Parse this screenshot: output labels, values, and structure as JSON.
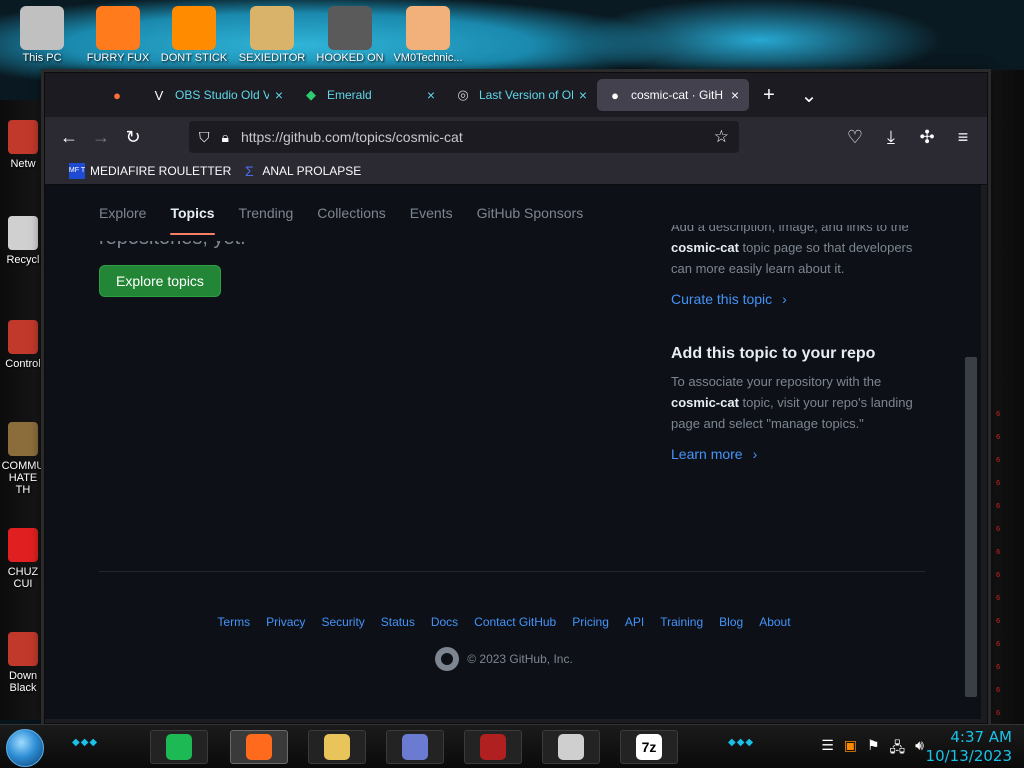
{
  "desktop": {
    "top_icons": [
      {
        "label": "This PC",
        "color": "#c0c0c0"
      },
      {
        "label": "FURRY FUX",
        "color": "#ff7b1c"
      },
      {
        "label": "DONT STICK",
        "color": "#ff8c00"
      },
      {
        "label": "SEXIEDITOR",
        "color": "#d9b36a"
      },
      {
        "label": "HOOKED ON",
        "color": "#5a5a5a"
      },
      {
        "label": "VM0Technic...",
        "color": "#f2b07a"
      }
    ],
    "left_icons": [
      {
        "label": "Netw",
        "color": "#c0392b"
      },
      {
        "label": "Recycl",
        "color": "#d0d0d0"
      },
      {
        "label": "Control",
        "color": "#c0392b"
      },
      {
        "label": "COMMU HATE TH",
        "color": "#8a6d3b"
      },
      {
        "label": "CHUZ CUI",
        "color": "#e02020"
      },
      {
        "label": "Down Black",
        "color": "#c0392b"
      }
    ],
    "right_markers": [
      "6",
      "6",
      "6",
      "6",
      "6",
      "6",
      "6",
      "6",
      "6",
      "6",
      "6",
      "6",
      "6",
      "6",
      "6"
    ]
  },
  "browser": {
    "tabs": [
      {
        "label": "",
        "icon": "firefox-icon",
        "pinned": true
      },
      {
        "label": "OBS Studio Old V",
        "icon": "v-icon"
      },
      {
        "label": "Emerald",
        "icon": "emerald-icon"
      },
      {
        "label": "Last Version of OB",
        "icon": "obs-icon"
      },
      {
        "label": "cosmic-cat · GitH",
        "icon": "github-icon",
        "active": true
      }
    ],
    "url": "https://github.com/topics/cosmic-cat",
    "bookmarks": [
      {
        "label": "MEDIAFIRE ROULETTER",
        "icon_text": "MF T"
      },
      {
        "label": "ANAL PROLAPSE",
        "icon_text": "Σ"
      }
    ]
  },
  "page": {
    "subnav": [
      "Explore",
      "Topics",
      "Trending",
      "Collections",
      "Events",
      "GitHub Sponsors"
    ],
    "active_subnav": "Topics",
    "cut_text": "repositories, yet.",
    "explore_button": "Explore topics",
    "sidebar": {
      "para1_pre": "Add a description, image, and links to the",
      "topic": "cosmic-cat",
      "para1_post": "topic page so that developers can more easily learn about it.",
      "curate_link": "Curate this topic",
      "heading": "Add this topic to your repo",
      "para2_pre": "To associate your repository with the",
      "para2_post": "topic, visit your repo's landing page and select \"manage topics.\"",
      "learn_link": "Learn more"
    },
    "footer_links": [
      "Terms",
      "Privacy",
      "Security",
      "Status",
      "Docs",
      "Contact GitHub",
      "Pricing",
      "API",
      "Training",
      "Blog",
      "About"
    ],
    "copyright": "© 2023 GitHub, Inc."
  },
  "taskbar": {
    "apps": [
      {
        "name": "spotify",
        "color": "#1db954"
      },
      {
        "name": "firefox",
        "color": "#ff6a1c",
        "active": true
      },
      {
        "name": "file-explorer",
        "color": "#e8c45a"
      },
      {
        "name": "control-panel",
        "color": "#6a7bd1"
      },
      {
        "name": "camera",
        "color": "#b02020"
      },
      {
        "name": "obs",
        "color": "#cfcfcf"
      },
      {
        "name": "7zip",
        "color": "#ffffff",
        "label": "7z"
      }
    ],
    "time": "4:37 AM",
    "date": "10/13/2023"
  }
}
